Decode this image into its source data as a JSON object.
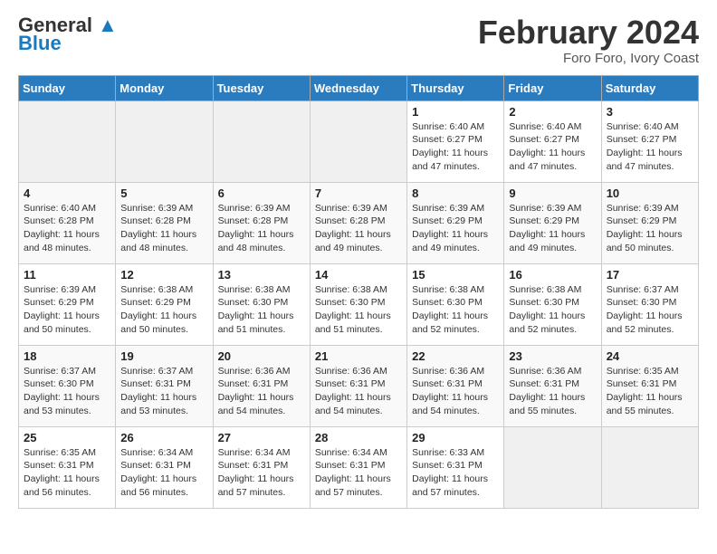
{
  "header": {
    "logo_line1": "General",
    "logo_line2": "Blue",
    "title": "February 2024",
    "subtitle": "Foro Foro, Ivory Coast"
  },
  "days_of_week": [
    "Sunday",
    "Monday",
    "Tuesday",
    "Wednesday",
    "Thursday",
    "Friday",
    "Saturday"
  ],
  "weeks": [
    [
      {
        "day": "",
        "info": ""
      },
      {
        "day": "",
        "info": ""
      },
      {
        "day": "",
        "info": ""
      },
      {
        "day": "",
        "info": ""
      },
      {
        "day": "1",
        "info": "Sunrise: 6:40 AM\nSunset: 6:27 PM\nDaylight: 11 hours and 47 minutes."
      },
      {
        "day": "2",
        "info": "Sunrise: 6:40 AM\nSunset: 6:27 PM\nDaylight: 11 hours and 47 minutes."
      },
      {
        "day": "3",
        "info": "Sunrise: 6:40 AM\nSunset: 6:27 PM\nDaylight: 11 hours and 47 minutes."
      }
    ],
    [
      {
        "day": "4",
        "info": "Sunrise: 6:40 AM\nSunset: 6:28 PM\nDaylight: 11 hours and 48 minutes."
      },
      {
        "day": "5",
        "info": "Sunrise: 6:39 AM\nSunset: 6:28 PM\nDaylight: 11 hours and 48 minutes."
      },
      {
        "day": "6",
        "info": "Sunrise: 6:39 AM\nSunset: 6:28 PM\nDaylight: 11 hours and 48 minutes."
      },
      {
        "day": "7",
        "info": "Sunrise: 6:39 AM\nSunset: 6:28 PM\nDaylight: 11 hours and 49 minutes."
      },
      {
        "day": "8",
        "info": "Sunrise: 6:39 AM\nSunset: 6:29 PM\nDaylight: 11 hours and 49 minutes."
      },
      {
        "day": "9",
        "info": "Sunrise: 6:39 AM\nSunset: 6:29 PM\nDaylight: 11 hours and 49 minutes."
      },
      {
        "day": "10",
        "info": "Sunrise: 6:39 AM\nSunset: 6:29 PM\nDaylight: 11 hours and 50 minutes."
      }
    ],
    [
      {
        "day": "11",
        "info": "Sunrise: 6:39 AM\nSunset: 6:29 PM\nDaylight: 11 hours and 50 minutes."
      },
      {
        "day": "12",
        "info": "Sunrise: 6:38 AM\nSunset: 6:29 PM\nDaylight: 11 hours and 50 minutes."
      },
      {
        "day": "13",
        "info": "Sunrise: 6:38 AM\nSunset: 6:30 PM\nDaylight: 11 hours and 51 minutes."
      },
      {
        "day": "14",
        "info": "Sunrise: 6:38 AM\nSunset: 6:30 PM\nDaylight: 11 hours and 51 minutes."
      },
      {
        "day": "15",
        "info": "Sunrise: 6:38 AM\nSunset: 6:30 PM\nDaylight: 11 hours and 52 minutes."
      },
      {
        "day": "16",
        "info": "Sunrise: 6:38 AM\nSunset: 6:30 PM\nDaylight: 11 hours and 52 minutes."
      },
      {
        "day": "17",
        "info": "Sunrise: 6:37 AM\nSunset: 6:30 PM\nDaylight: 11 hours and 52 minutes."
      }
    ],
    [
      {
        "day": "18",
        "info": "Sunrise: 6:37 AM\nSunset: 6:30 PM\nDaylight: 11 hours and 53 minutes."
      },
      {
        "day": "19",
        "info": "Sunrise: 6:37 AM\nSunset: 6:31 PM\nDaylight: 11 hours and 53 minutes."
      },
      {
        "day": "20",
        "info": "Sunrise: 6:36 AM\nSunset: 6:31 PM\nDaylight: 11 hours and 54 minutes."
      },
      {
        "day": "21",
        "info": "Sunrise: 6:36 AM\nSunset: 6:31 PM\nDaylight: 11 hours and 54 minutes."
      },
      {
        "day": "22",
        "info": "Sunrise: 6:36 AM\nSunset: 6:31 PM\nDaylight: 11 hours and 54 minutes."
      },
      {
        "day": "23",
        "info": "Sunrise: 6:36 AM\nSunset: 6:31 PM\nDaylight: 11 hours and 55 minutes."
      },
      {
        "day": "24",
        "info": "Sunrise: 6:35 AM\nSunset: 6:31 PM\nDaylight: 11 hours and 55 minutes."
      }
    ],
    [
      {
        "day": "25",
        "info": "Sunrise: 6:35 AM\nSunset: 6:31 PM\nDaylight: 11 hours and 56 minutes."
      },
      {
        "day": "26",
        "info": "Sunrise: 6:34 AM\nSunset: 6:31 PM\nDaylight: 11 hours and 56 minutes."
      },
      {
        "day": "27",
        "info": "Sunrise: 6:34 AM\nSunset: 6:31 PM\nDaylight: 11 hours and 57 minutes."
      },
      {
        "day": "28",
        "info": "Sunrise: 6:34 AM\nSunset: 6:31 PM\nDaylight: 11 hours and 57 minutes."
      },
      {
        "day": "29",
        "info": "Sunrise: 6:33 AM\nSunset: 6:31 PM\nDaylight: 11 hours and 57 minutes."
      },
      {
        "day": "",
        "info": ""
      },
      {
        "day": "",
        "info": ""
      }
    ]
  ]
}
